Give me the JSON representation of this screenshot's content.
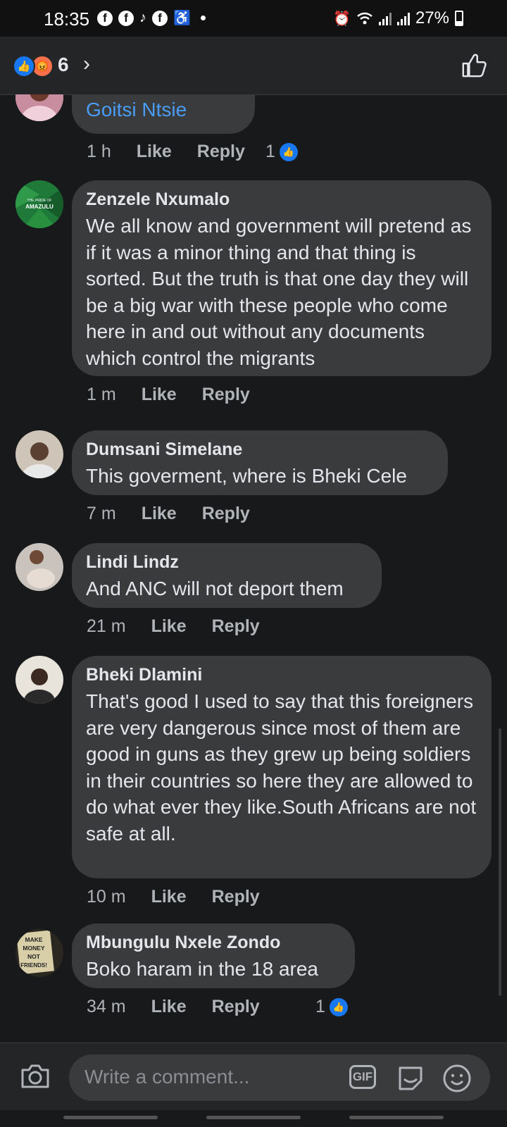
{
  "status_bar": {
    "time": "18:35",
    "battery": "27%",
    "icons": [
      "facebook-icon",
      "facebook-icon",
      "tiktok-icon",
      "facebook-icon",
      "accessibility-icon",
      "alarm-icon",
      "wifi-icon",
      "signal-icon",
      "signal-icon",
      "battery-icon"
    ]
  },
  "header": {
    "reaction_count": "6",
    "reactions": [
      "like",
      "angry"
    ]
  },
  "comments": [
    {
      "author": "",
      "link_text": "Goitsi Ntsie",
      "time": "1 h",
      "like": "Like",
      "reply": "Reply",
      "reaction_count": "1"
    },
    {
      "author": "Zenzele Nxumalo",
      "avatar_text": [
        "THE PRIDE OF",
        "AMAZULU"
      ],
      "text": "We all know and government will pretend as if it was a minor thing and that thing is sorted. But the truth is that one day they will be a big war with these people who come here in and out without any documents which control the migrants",
      "time": "1 m",
      "like": "Like",
      "reply": "Reply"
    },
    {
      "author": "Dumsani Simelane",
      "text": "This goverment, where is Bheki Cele",
      "time": "7 m",
      "like": "Like",
      "reply": "Reply"
    },
    {
      "author": "Lindi Lindz",
      "text": "And ANC will not deport them",
      "time": "21 m",
      "like": "Like",
      "reply": "Reply"
    },
    {
      "author": "Bheki Dlamini",
      "text": "That's good I used to say that this foreigners are very dangerous since most of them are good in guns as they grew up being soldiers in their countries so here they are allowed to do what ever they like.South Africans are not safe at all.",
      "time": "10 m",
      "like": "Like",
      "reply": "Reply"
    },
    {
      "author": "Mbungulu Nxele Zondo",
      "avatar_text": [
        "MAKE",
        "MONEY",
        "NOT",
        "FRIENDS!"
      ],
      "text": "Boko haram in the 18 area",
      "time": "34 m",
      "like": "Like",
      "reply": "Reply",
      "reaction_count": "1"
    }
  ],
  "composer": {
    "placeholder": "Write a comment...",
    "gif_label": "GIF"
  },
  "colors": {
    "background": "#18191a",
    "bubble": "#3a3b3c",
    "link": "#4a9cf4",
    "like_blue": "#1877f2",
    "angry_orange": "#f7714c"
  }
}
